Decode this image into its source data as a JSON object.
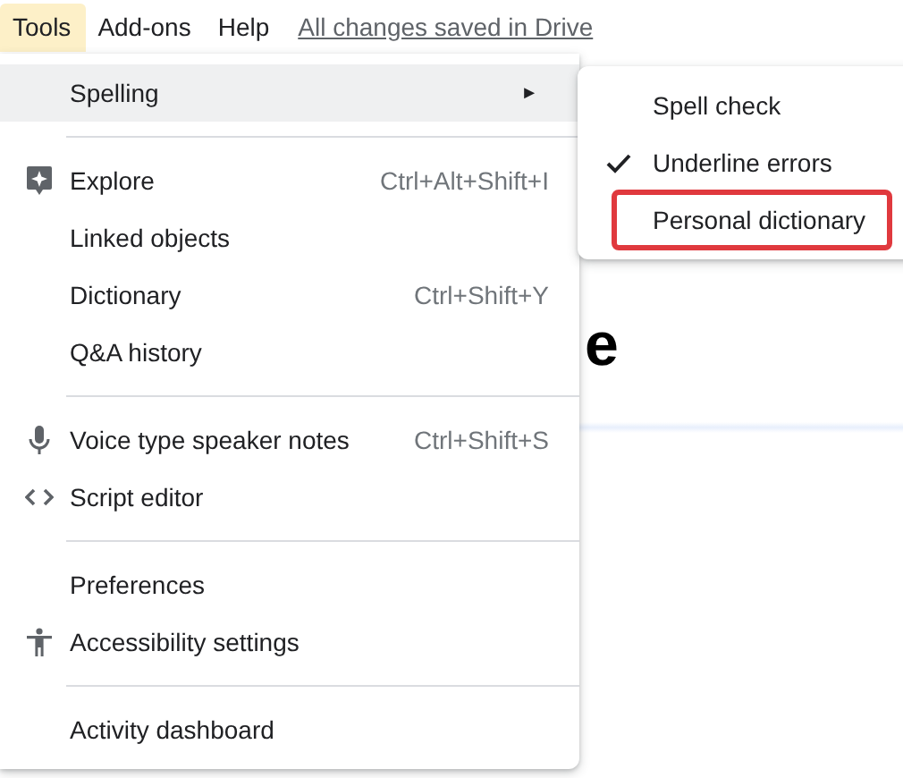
{
  "menu_bar": [
    {
      "label": "Tools",
      "selected": true
    },
    {
      "label": "Add-ons",
      "selected": false
    },
    {
      "label": "Help",
      "selected": false
    }
  ],
  "save_status": "All changes saved in Drive",
  "background_text": "e",
  "tools_menu": [
    {
      "kind": "submenu",
      "label": "Spelling",
      "arrow": "►",
      "selected": true
    },
    {
      "kind": "separator"
    },
    {
      "kind": "item",
      "label": "Explore",
      "shortcut": "Ctrl+Alt+Shift+I",
      "selected": false
    },
    {
      "kind": "item",
      "label": "Linked objects",
      "selected": false
    },
    {
      "kind": "item",
      "label": "Dictionary",
      "shortcut": "Ctrl+Shift+Y",
      "selected": false
    },
    {
      "kind": "item",
      "label": "Q&A history",
      "selected": false
    },
    {
      "kind": "separator"
    },
    {
      "kind": "item",
      "label": "Voice type speaker notes",
      "shortcut": "Ctrl+Shift+S",
      "selected": false
    },
    {
      "kind": "item",
      "label": "Script editor",
      "selected": false
    },
    {
      "kind": "separator"
    },
    {
      "kind": "item",
      "label": "Preferences",
      "selected": false
    },
    {
      "kind": "item",
      "label": "Accessibility settings",
      "selected": false
    },
    {
      "kind": "separator"
    },
    {
      "kind": "item",
      "label": "Activity dashboard",
      "selected": false
    }
  ],
  "spelling_submenu": [
    {
      "label": "Spell check",
      "checked": false,
      "highlighted": false
    },
    {
      "label": "Underline errors",
      "checked": true,
      "highlighted": false
    },
    {
      "label": "Personal dictionary",
      "checked": false,
      "highlighted": true
    }
  ]
}
